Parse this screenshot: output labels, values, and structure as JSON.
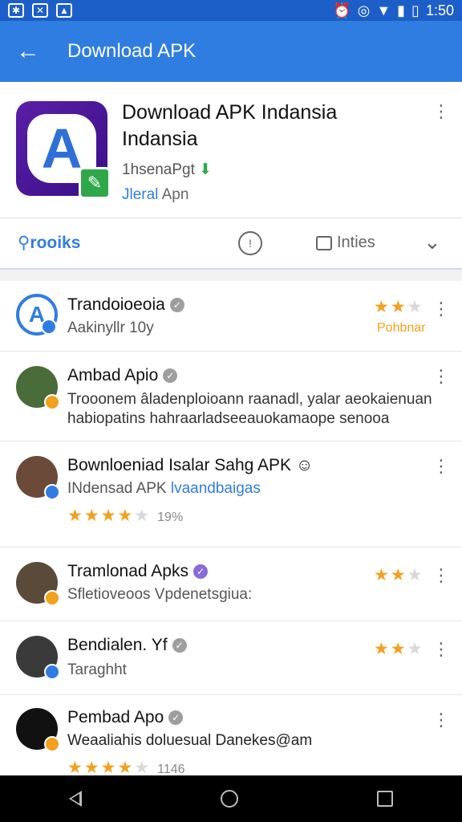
{
  "status_bar": {
    "time": "1:50"
  },
  "app_bar": {
    "title": "Download APK",
    "back_icon": "arrow-left-icon"
  },
  "app": {
    "title": "Download APK Indansia Indansia",
    "developer": "1hsenaPgt",
    "tag_blue": "Jleral",
    "tag_rest": " Apn",
    "icon_letter": "A"
  },
  "tabs": {
    "active_label": "rooiks",
    "notes_label": "Inties"
  },
  "reviews": [
    {
      "name": "Trandoioeoia",
      "text": "Aakinyllr 10y",
      "stars": 2.5,
      "tag": "Pohbnar",
      "avatar_color": "#2f7de1"
    },
    {
      "name": "Ambad Apio",
      "text": "Trooonem âladenploioann raanadl, yalar aeokaienuan habiopatins hahraarladseeauokamaope senooa",
      "avatar_color": "#4a6b3a"
    },
    {
      "name": "Bownloeniad Isalar Sahg APK",
      "text_main": "INdensad APK ",
      "text_blue": "lvaandbaigas",
      "stars": 4,
      "meta": "19%",
      "avatar_color": "#6b4a3a"
    },
    {
      "name": "Tramlonad Apks",
      "text": "Sfletioveoos Vpdenetsgiua:",
      "stars": 2.5,
      "avatar_color": "#5a4a3a"
    },
    {
      "name": "Bendialen. Yf",
      "text": "Taraghht",
      "stars": 2.5,
      "avatar_color": "#3a3a3a"
    },
    {
      "name": "Pembad Apo",
      "text": "Weaaliahis doluesual Danekes@am",
      "stars": 4,
      "meta": "1146",
      "avatar_color": "#111111"
    }
  ],
  "colors": {
    "accent": "#2f7de1",
    "status_bar": "#1d5fc9",
    "star": "#f2a01d"
  }
}
